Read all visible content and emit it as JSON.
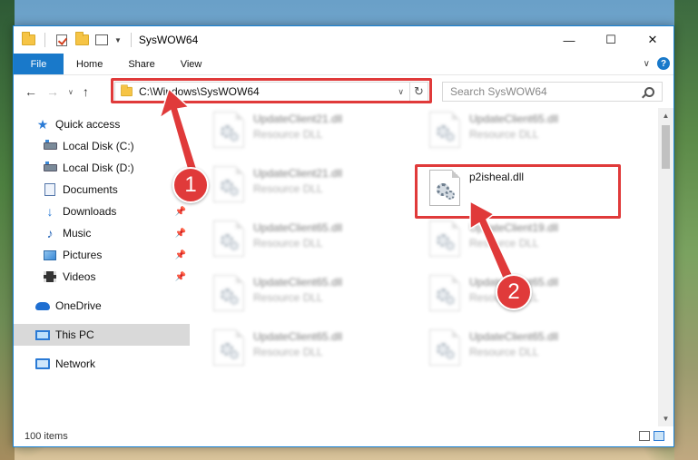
{
  "window": {
    "title": "SysWOW64",
    "controls": {
      "minimize": "—",
      "maximize": "☐",
      "close": "✕"
    }
  },
  "ribbon": {
    "tabs": [
      "File",
      "Home",
      "Share",
      "View"
    ],
    "expand": "∨",
    "help": "?"
  },
  "address": {
    "path": "C:\\Windows\\SysWOW64",
    "dropdown": "∨",
    "refresh": "↻"
  },
  "search": {
    "placeholder": "Search SysWOW64"
  },
  "nav_buttons": {
    "back": "←",
    "forward": "→",
    "recent": "∨",
    "up": "↑"
  },
  "sidebar": {
    "items": [
      {
        "label": "Quick access",
        "icon": "star-icon"
      },
      {
        "label": "Local Disk (C:)",
        "icon": "drive-icon"
      },
      {
        "label": "Local Disk (D:)",
        "icon": "drive-icon"
      },
      {
        "label": "Documents",
        "icon": "documents-icon"
      },
      {
        "label": "Downloads",
        "icon": "downloads-icon",
        "pinned": true
      },
      {
        "label": "Music",
        "icon": "music-icon",
        "pinned": true
      },
      {
        "label": "Pictures",
        "icon": "pictures-icon",
        "pinned": true
      },
      {
        "label": "Videos",
        "icon": "videos-icon",
        "pinned": true
      },
      {
        "label": "OneDrive",
        "icon": "cloud-icon"
      },
      {
        "label": "This PC",
        "icon": "computer-icon",
        "selected": true
      },
      {
        "label": "Network",
        "icon": "network-icon"
      }
    ],
    "pin_glyph": "📌"
  },
  "files": [
    {
      "name": "UpdateClient21.dll",
      "type": "Resource DLL",
      "blurred": true
    },
    {
      "name": "UpdateClient65.dll",
      "type": "Resource DLL",
      "blurred": true
    },
    {
      "name": "UpdateClient21.dll",
      "type": "Resource DLL",
      "blurred": true
    },
    {
      "name": "p2isheal.dll",
      "type": "",
      "blurred": false,
      "highlighted": true
    },
    {
      "name": "UpdateClient65.dll",
      "type": "Resource DLL",
      "blurred": true
    },
    {
      "name": "UpdateClient19.dll",
      "type": "Resource DLL",
      "blurred": true
    },
    {
      "name": "UpdateClient65.dll",
      "type": "Resource DLL",
      "blurred": true
    },
    {
      "name": "UpdateClient65.dll",
      "type": "Resource DLL",
      "blurred": true
    },
    {
      "name": "UpdateClient65.dll",
      "type": "Resource DLL",
      "blurred": true
    },
    {
      "name": "UpdateClient65.dll",
      "type": "Resource DLL",
      "blurred": true
    }
  ],
  "status": {
    "count": "100 items"
  },
  "annotations": {
    "step1": "1",
    "step2": "2",
    "color": "#e03a3a"
  }
}
